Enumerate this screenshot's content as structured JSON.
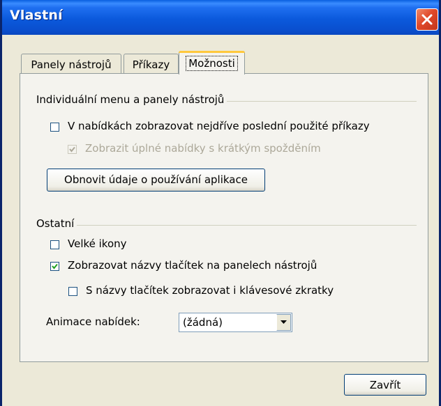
{
  "window": {
    "title": "Vlastní"
  },
  "tabs": [
    {
      "label": "Panely nástrojů",
      "active": false
    },
    {
      "label": "Příkazy",
      "active": false
    },
    {
      "label": "Možnosti",
      "active": true
    }
  ],
  "group1": {
    "title": "Individuální menu a panely nástrojů",
    "option1": {
      "label": "V nabídkách zobrazovat nejdříve poslední použité příkazy",
      "checked": false
    },
    "option2": {
      "label": "Zobrazit úplné nabídky s krátkým spožděním",
      "checked": true,
      "disabled": true
    },
    "reset_button": "Obnovit údaje o používání aplikace"
  },
  "group2": {
    "title": "Ostatní",
    "large_icons": {
      "label": "Velké ikony",
      "checked": false
    },
    "show_tooltips": {
      "label": "Zobrazovat názvy tlačítek na panelech nástrojů",
      "checked": true
    },
    "show_shortcuts": {
      "label": "S názvy tlačítek zobrazovat i klávesové zkratky",
      "checked": false
    },
    "animation_label": "Animace nabídek:",
    "animation_value": "(žádná)"
  },
  "footer": {
    "close_button": "Zavřít"
  },
  "colors": {
    "titlebar": "#0a5fe0",
    "close": "#e0492a",
    "face": "#ece9d8",
    "tab_highlight": "#ffc83c"
  }
}
